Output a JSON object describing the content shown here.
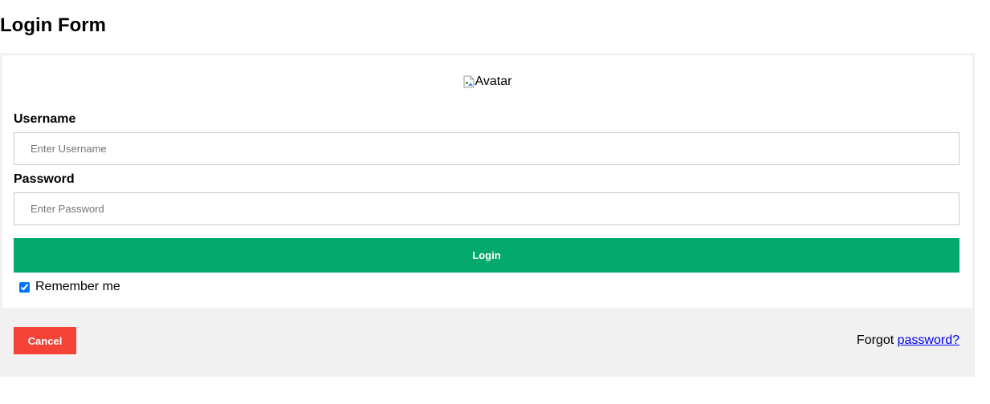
{
  "page": {
    "title": "Login Form"
  },
  "avatar": {
    "alt_text": "Avatar"
  },
  "username": {
    "label": "Username",
    "placeholder": "Enter Username",
    "value": ""
  },
  "password": {
    "label": "Password",
    "placeholder": "Enter Password",
    "value": ""
  },
  "login_button": {
    "label": "Login"
  },
  "remember": {
    "label": "Remember me",
    "checked": true
  },
  "footer": {
    "cancel_label": "Cancel",
    "forgot_prefix": "Forgot",
    "forgot_link": "password?"
  },
  "colors": {
    "login_button": "#04aa6d",
    "cancel_button": "#f44336",
    "footer_background": "#f1f1f1",
    "link": "#0000ee"
  },
  "icons": {
    "avatar": "broken-image-icon"
  }
}
